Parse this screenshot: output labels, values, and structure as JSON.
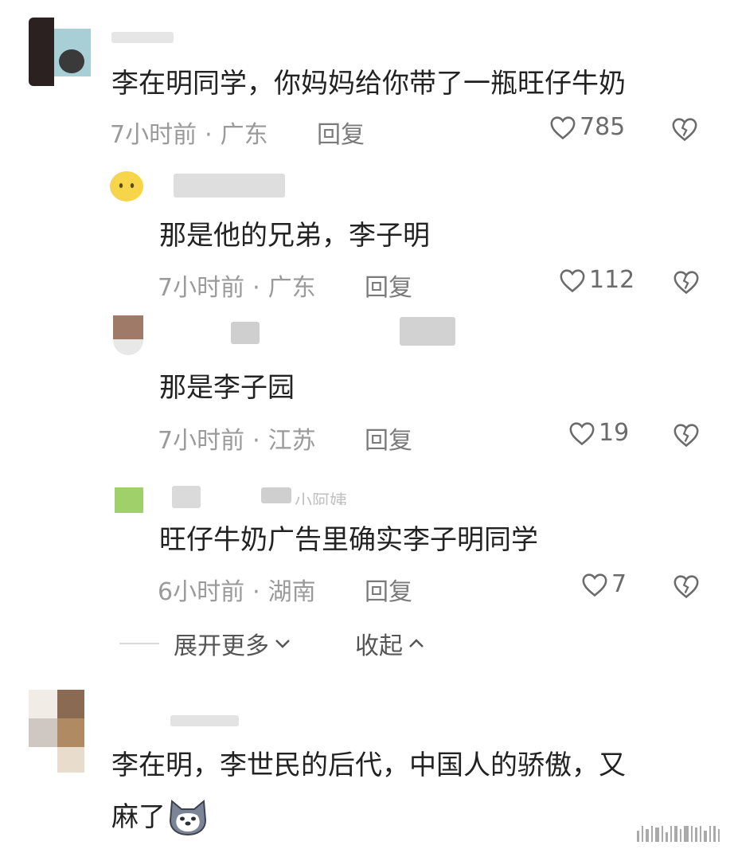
{
  "comments": [
    {
      "username": "",
      "text": "李在明同学，你妈妈给你带了一瓶旺仔牛奶",
      "time": "7小时前",
      "location": "广东",
      "reply": "回复",
      "likes": "785"
    },
    {
      "username": "",
      "text": "那是他的兄弟，李子明",
      "time": "7小时前",
      "location": "广东",
      "reply": "回复",
      "likes": "112"
    },
    {
      "username": "",
      "text": "那是李子园",
      "time": "7小时前",
      "location": "江苏",
      "reply": "回复",
      "likes": "19"
    },
    {
      "username": "小阿姨",
      "text": "旺仔牛奶广告里确实李子明同学",
      "time": "6小时前",
      "location": "湖南",
      "reply": "回复",
      "likes": "7"
    },
    {
      "username": "",
      "text_line1": "李在明，李世民的后代，中国人的骄傲，又",
      "text_line2": "麻了"
    }
  ],
  "expand": {
    "more": "展开更多",
    "collapse": "收起"
  },
  "separator": "·",
  "colors": {
    "meta": "#9a9a9a",
    "text": "#222222",
    "icon": "#6b6b6b"
  },
  "icons": {
    "like": "heart-outline-icon",
    "dislike": "broken-heart-icon",
    "emoji_face": "smiley-face-icon",
    "emoji_dog": "husky-dog-emoji"
  }
}
